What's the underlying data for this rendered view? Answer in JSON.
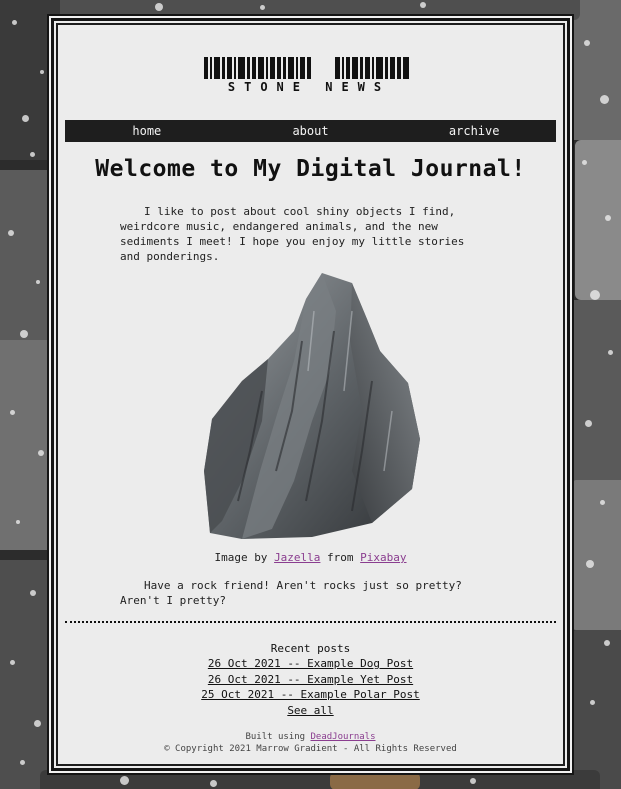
{
  "logo": {
    "text": "STONE NEWS"
  },
  "nav": {
    "items": [
      {
        "label": "home"
      },
      {
        "label": "about"
      },
      {
        "label": "archive"
      }
    ]
  },
  "main": {
    "title": "Welcome to My Digital Journal!",
    "intro": "I like to post about cool shiny objects I find, weirdcore music, endangered animals, and the new sediments I meet! I hope you enjoy my little stories and ponderings.",
    "caption": {
      "prefix": "Image by",
      "author": "Jazella",
      "middle": "from",
      "source": "Pixabay"
    },
    "outro": "Have a rock friend! Aren't rocks just so pretty? Aren't I pretty?"
  },
  "recent": {
    "title": "Recent posts",
    "posts": [
      {
        "label": "26 Oct 2021 -- Example Dog Post"
      },
      {
        "label": "26 Oct 2021 -- Example Yet Post"
      },
      {
        "label": "25 Oct 2021 -- Example Polar Post"
      }
    ],
    "see_all": "See all"
  },
  "footer": {
    "built_prefix": "Built using",
    "built_link": "DeadJournals",
    "copyright": "© Copyright 2021 Marrow Gradient - All Rights Reserved"
  },
  "colors": {
    "link_visited": "#8a3d8f",
    "nav_bg": "#1e1e1e",
    "page_bg": "#ececec",
    "text": "#111111"
  }
}
